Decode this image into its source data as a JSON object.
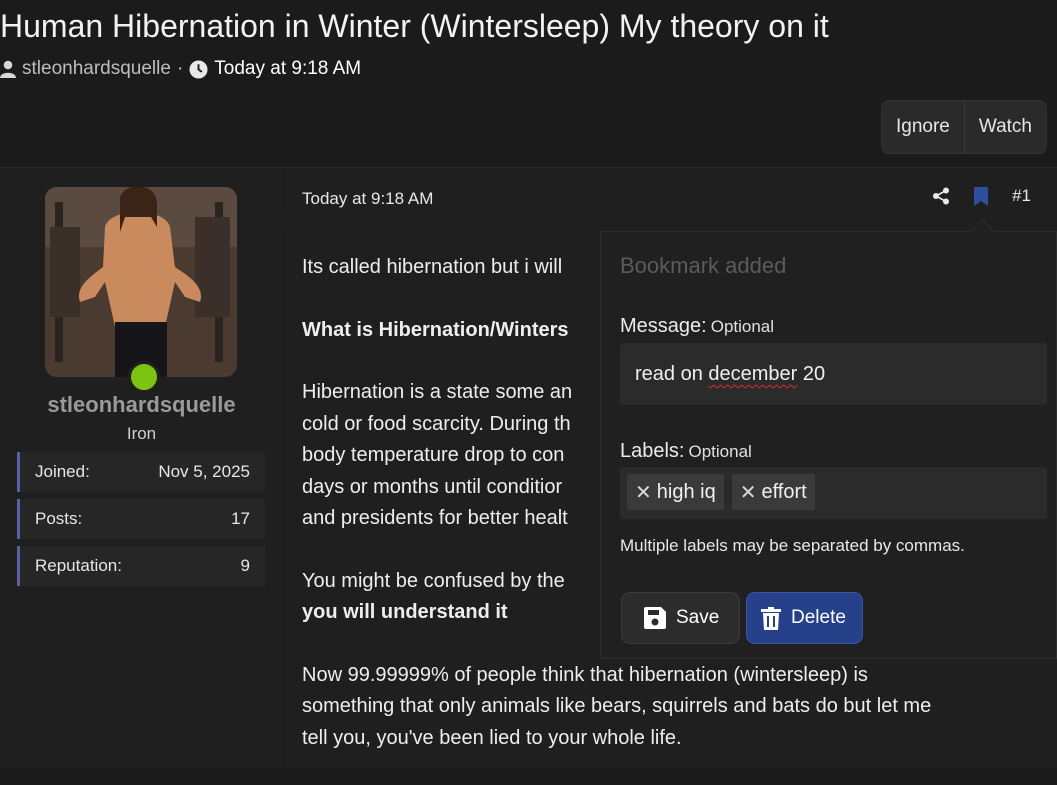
{
  "thread": {
    "title": "Human Hibernation in Winter (Wintersleep) My theory on it",
    "author": "stleonhardsquelle",
    "separator": "·",
    "date": "Today at 9:18 AM"
  },
  "thread_actions": {
    "ignore_label": "Ignore",
    "watch_label": "Watch"
  },
  "user": {
    "name": "stleonhardsquelle",
    "rank": "Iron",
    "stats": [
      {
        "label": "Joined:",
        "value": "Nov 5, 2025"
      },
      {
        "label": "Posts:",
        "value": "17"
      },
      {
        "label": "Reputation:",
        "value": "9"
      }
    ]
  },
  "post": {
    "date": "Today at 9:18 AM",
    "number": "#1",
    "p1": "Its called hibernation but i will",
    "p2_bold": "What is Hibernation/Winters",
    "p3_l1": "Hibernation is a state some an",
    "p3_l2": "cold or food scarcity. During th",
    "p3_l3": "body temperature drop to con",
    "p3_l4": "days or months until conditior",
    "p3_l5": "and presidents for better healt",
    "p4_l1": "You might be confused by the",
    "p4_bold": "you will understand it",
    "p5_l1": "Now 99.99999% of people think that hibernation (wintersleep) is",
    "p5_l2": "something that only animals like bears, squirrels and bats do but let me",
    "p5_l3": "tell you, you've been lied to your whole life."
  },
  "bookmark": {
    "title": "Bookmark added",
    "message_label": "Message:",
    "optional": "Optional",
    "message_value_pre": "read on ",
    "message_value_misspelled": "december",
    "message_value_post": " 20",
    "labels_label": "Labels:",
    "tags": [
      "high iq",
      "effort"
    ],
    "hint": "Multiple labels may be separated by commas.",
    "save_label": "Save",
    "delete_label": "Delete"
  },
  "colors": {
    "accent": "#26418a",
    "online": "#7ec312",
    "stat_bar": "#5b5fa8",
    "bookmark_icon": "#2f4f9e"
  }
}
